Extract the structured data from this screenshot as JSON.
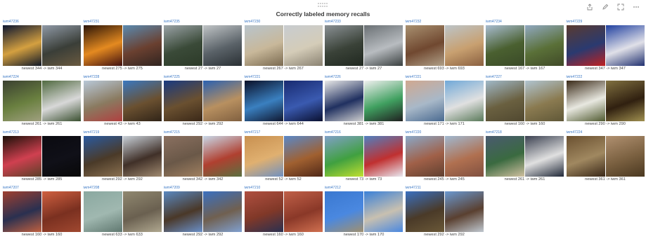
{
  "panel": {
    "title": "Correctly labeled memory recalls"
  },
  "toolbar": {
    "share_icon": "share-icon",
    "edit_icon": "pencil-icon",
    "expand_icon": "expand-icon",
    "more_icon": "ellipsis-icon"
  },
  "items": [
    {
      "id": "iwm47236",
      "caption": "newest 344 -> iwm 344",
      "left": [
        "#0a1430",
        "#d4a040",
        "#101828"
      ],
      "right": [
        "#8f99a6",
        "#3a3e38",
        "#6a5a40"
      ]
    },
    {
      "id": "iwm47231",
      "caption": "newest 275 -> iwm 275",
      "left": [
        "#2a1408",
        "#e48a20",
        "#401010"
      ],
      "right": [
        "#5a8ab0",
        "#6a4030",
        "#302420"
      ]
    },
    {
      "id": "iwm47235",
      "caption": "newest 27 -> iwm 27",
      "left": [
        "#9aa2a6",
        "#3a4a38",
        "#2c3a28"
      ],
      "right": [
        "#c0c4c6",
        "#5a6268",
        "#2a3034"
      ]
    },
    {
      "id": "iwm47230",
      "caption": "newest 267 -> iwm 267",
      "left": [
        "#b8c4cc",
        "#c8b89a",
        "#7a6a50"
      ],
      "right": [
        "#c8ccd0",
        "#d4ccb8",
        "#8a8272"
      ]
    },
    {
      "id": "iwm47233",
      "caption": "newest 27 -> iwm 27",
      "left": [
        "#8a9094",
        "#3a4238",
        "#202820"
      ],
      "right": [
        "#6a7074",
        "#b8bcc0",
        "#3a4040"
      ]
    },
    {
      "id": "iwm47232",
      "caption": "newest 693 -> iwm 693",
      "left": [
        "#a89070",
        "#704830",
        "#b0a088"
      ],
      "right": [
        "#bcc4c8",
        "#c8a070",
        "#8a6040"
      ]
    },
    {
      "id": "iwm47234",
      "caption": "newest 167 -> iwm 167",
      "left": [
        "#a8bcd0",
        "#4a6030",
        "#3a4a28"
      ],
      "right": [
        "#90a8c0",
        "#5a7038",
        "#404a28"
      ]
    },
    {
      "id": "iwm47229",
      "caption": "newest 347 -> iwm 347",
      "left": [
        "#5a3a30",
        "#2a3a70",
        "#c02020"
      ],
      "right": [
        "#2040a0",
        "#e0e0e8",
        "#203070"
      ]
    },
    {
      "id": "iwm47224",
      "caption": "newest 261 -> iwm 261",
      "left": [
        "#3a4030",
        "#6a8040",
        "#a0a080"
      ],
      "right": [
        "#506a40",
        "#d8d8d8",
        "#3a5030"
      ]
    },
    {
      "id": "iwm47228",
      "caption": "newest 43 -> iwm 43",
      "left": [
        "#b8c8d8",
        "#8a7a60",
        "#b04040"
      ],
      "right": [
        "#3a78c0",
        "#6a5030",
        "#302418"
      ]
    },
    {
      "id": "iwm47225",
      "caption": "newest 292 -> iwm 292",
      "left": [
        "#1a3a80",
        "#6a5030",
        "#3a2818"
      ],
      "right": [
        "#2a60b0",
        "#b89060",
        "#806040"
      ]
    },
    {
      "id": "iwm47221",
      "caption": "newest 644 -> iwm 644",
      "left": [
        "#0a1028",
        "#3a80c0",
        "#101830"
      ],
      "right": [
        "#182a70",
        "#3a5ab0",
        "#0a1030"
      ]
    },
    {
      "id": "iwm47226",
      "caption": "newest 381 -> iwm 381",
      "left": [
        "#e8e8e8",
        "#203060",
        "#d0d0d0"
      ],
      "right": [
        "#f0f0f0",
        "#40a060",
        "#202020"
      ]
    },
    {
      "id": "iwm47221",
      "caption": "newest 171 -> iwm 171",
      "left": [
        "#d0a890",
        "#a8b8c8",
        "#4a6a90"
      ],
      "right": [
        "#70a8d8",
        "#e0e0e0",
        "#5a7a5a"
      ]
    },
    {
      "id": "iwm47227",
      "caption": "newest 160 -> iwm 160",
      "left": [
        "#a0b8c8",
        "#6a6040",
        "#504830"
      ],
      "right": [
        "#b0c4d0",
        "#8a7a50",
        "#605838"
      ]
    },
    {
      "id": "iwm47222",
      "caption": "newest 290 -> iwm 290",
      "left": [
        "#3a2a18",
        "#e8e8e0",
        "#505a30"
      ],
      "right": [
        "#807040",
        "#302010",
        "#a09050"
      ]
    },
    {
      "id": "iwm47213",
      "caption": "newest 285 -> iwm 285",
      "left": [
        "#1a1008",
        "#d04050",
        "#5a4028"
      ],
      "right": [
        "#0a0a10",
        "#101018",
        "#080808"
      ]
    },
    {
      "id": "iwm47219",
      "caption": "newest 292 -> iwm 292",
      "left": [
        "#2a5aa0",
        "#4a3a28",
        "#8a7050"
      ],
      "right": [
        "#c8d0d8",
        "#403028",
        "#a08a70"
      ]
    },
    {
      "id": "iwm47215",
      "caption": "newest 342 -> iwm 342",
      "left": [
        "#8a7060",
        "#6a5848",
        "#a08060"
      ],
      "right": [
        "#c8d8e8",
        "#b04030",
        "#5a7040"
      ]
    },
    {
      "id": "iwm47217",
      "caption": "newest 52 -> iwm 52",
      "left": [
        "#c89050",
        "#e0b070",
        "#7090c0"
      ],
      "right": [
        "#5a88c8",
        "#a06030",
        "#502818"
      ]
    },
    {
      "id": "iwm47216",
      "caption": "newest 73 -> iwm 73",
      "left": [
        "#80a0c8",
        "#40a040",
        "#c0e030"
      ],
      "right": [
        "#5080c0",
        "#c03030",
        "#e8e8f0"
      ]
    },
    {
      "id": "iwm47220",
      "caption": "newest 245 -> iwm 245",
      "left": [
        "#8aa8c8",
        "#a06048",
        "#604030"
      ],
      "right": [
        "#a0b8d0",
        "#b07050",
        "#805040"
      ]
    },
    {
      "id": "iwm47218",
      "caption": "newest 261 -> iwm 261",
      "left": [
        "#4a5a70",
        "#3a6a40",
        "#d0c0a0"
      ],
      "right": [
        "#3a4050",
        "#e0e0e0",
        "#202838"
      ]
    },
    {
      "id": "iwm47224",
      "caption": "newest 361 -> iwm 361",
      "left": [
        "#6a5030",
        "#a08860",
        "#3a2818"
      ],
      "right": [
        "#b09070",
        "#7a6040",
        "#4a3820"
      ]
    },
    {
      "id": "iwm47207",
      "caption": "newest 160 -> iwm 160",
      "left": [
        "#a04030",
        "#2a3050",
        "#c06040"
      ],
      "right": [
        "#d06040",
        "#7a3020",
        "#a04830"
      ]
    },
    {
      "id": "iwm47208",
      "caption": "newest 633 -> iwm 633",
      "left": [
        "#8aa8a0",
        "#a0b8b0",
        "#607870"
      ],
      "right": [
        "#908870",
        "#6a6050",
        "#b0a890"
      ]
    },
    {
      "id": "iwm47209",
      "caption": "newest 292 -> iwm 292",
      "left": [
        "#5a88c0",
        "#4a3828",
        "#6a90c8"
      ],
      "right": [
        "#3a70c0",
        "#706050",
        "#80a0d0"
      ]
    },
    {
      "id": "iwm47210",
      "caption": "newest 160 -> iwm 160",
      "left": [
        "#b05040",
        "#803828",
        "#2a3050"
      ],
      "right": [
        "#c06048",
        "#8a3828",
        "#d07050"
      ]
    },
    {
      "id": "iwm47212",
      "caption": "newest 170 -> iwm 170",
      "left": [
        "#3a78d0",
        "#4a88e0",
        "#a09070"
      ],
      "right": [
        "#3a80d8",
        "#c8c0b0",
        "#4a88e0"
      ]
    },
    {
      "id": "iwm47211",
      "caption": "newest 292 -> iwm 292",
      "left": [
        "#3a70c0",
        "#4a3a28",
        "#6a5838"
      ],
      "right": [
        "#6a98d0",
        "#5a4030",
        "#c0c8d0"
      ]
    }
  ]
}
